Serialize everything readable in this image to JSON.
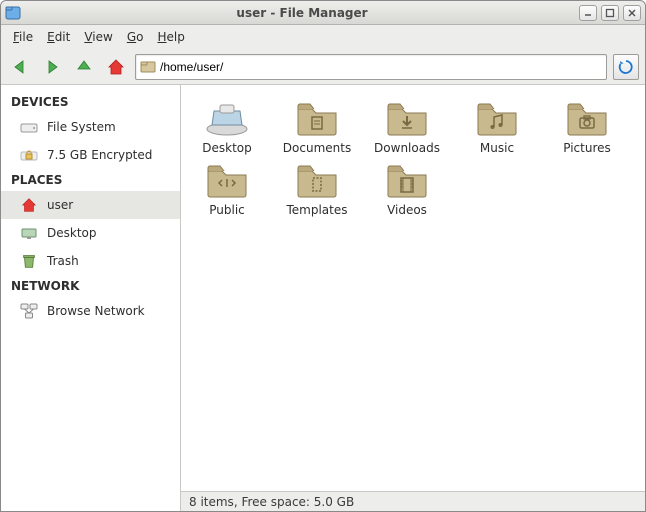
{
  "window": {
    "title": "user - File Manager"
  },
  "menu": {
    "file": "File",
    "edit": "Edit",
    "view": "View",
    "go": "Go",
    "help": "Help"
  },
  "path": "/home/user/",
  "sidebar": {
    "devices": {
      "header": "DEVICES",
      "filesystem": "File System",
      "encrypted": "7.5 GB Encrypted"
    },
    "places": {
      "header": "PLACES",
      "user": "user",
      "desktop": "Desktop",
      "trash": "Trash"
    },
    "network": {
      "header": "NETWORK",
      "browse": "Browse Network"
    }
  },
  "files": {
    "desktop": "Desktop",
    "documents": "Documents",
    "downloads": "Downloads",
    "music": "Music",
    "pictures": "Pictures",
    "public": "Public",
    "templates": "Templates",
    "videos": "Videos"
  },
  "status": "8 items, Free space: 5.0 GB"
}
